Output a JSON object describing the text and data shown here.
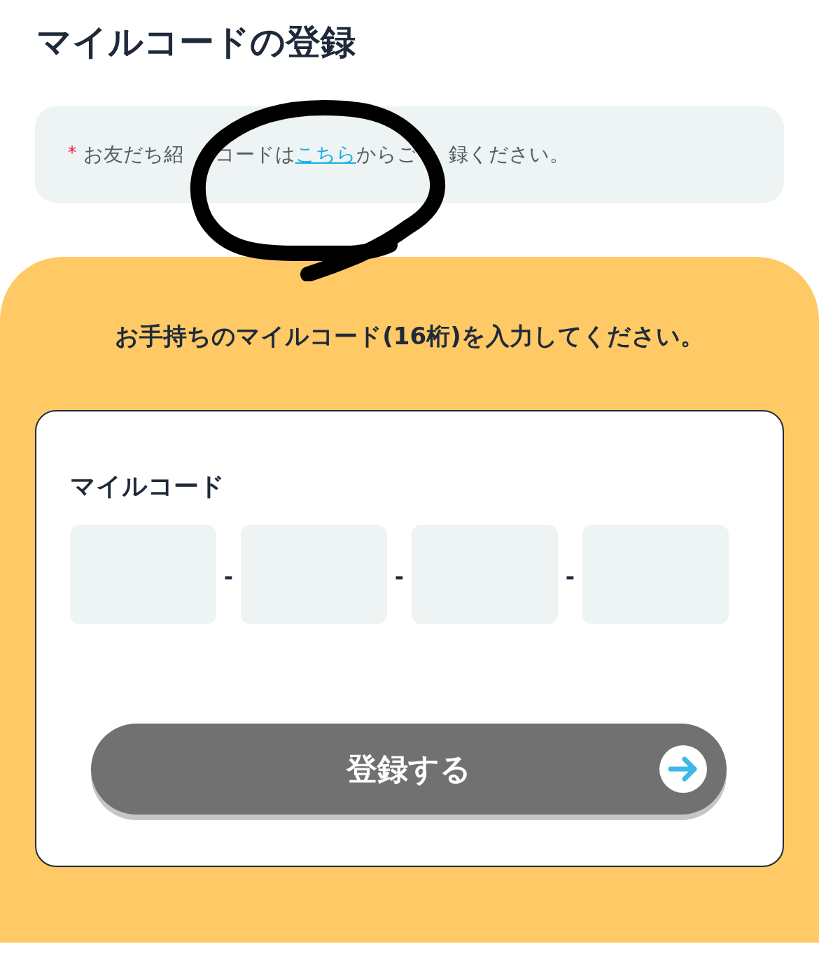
{
  "title": "マイルコードの登録",
  "notice": {
    "marker": "*",
    "segments": [
      {
        "kind": "text",
        "text": "お友だち紹"
      },
      {
        "kind": "covered"
      },
      {
        "kind": "text",
        "text": "コードは"
      },
      {
        "kind": "link",
        "text": "こちら"
      },
      {
        "kind": "text",
        "text": "からご"
      },
      {
        "kind": "covered"
      },
      {
        "kind": "text",
        "text": "録ください。"
      }
    ]
  },
  "annotation": {
    "kind": "circle"
  },
  "instruction": "お手持ちのマイルコード(16桁)を入力してください。",
  "form": {
    "label": "マイルコード",
    "fields": [
      {
        "kind": "input"
      },
      {
        "kind": "input"
      },
      {
        "kind": "input"
      },
      {
        "kind": "input"
      }
    ],
    "separators": [
      "-",
      "-",
      "-"
    ]
  },
  "submit": {
    "label": "登録する",
    "disabled": true
  }
}
